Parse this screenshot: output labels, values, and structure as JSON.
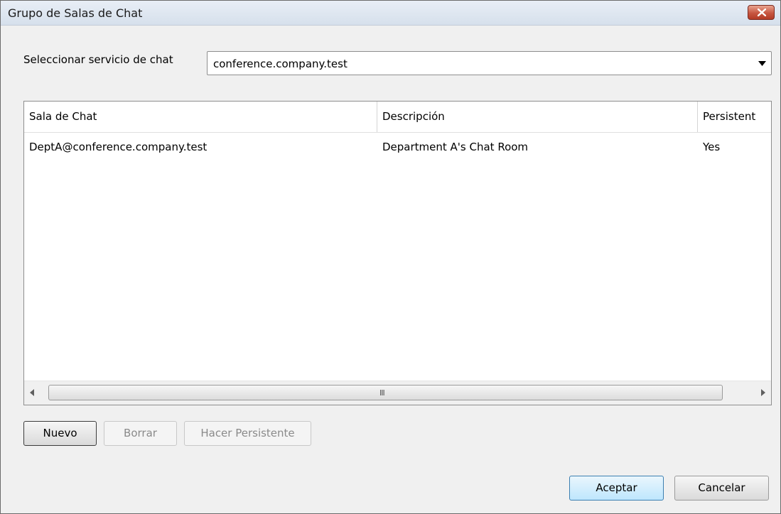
{
  "window": {
    "title": "Grupo de Salas de Chat"
  },
  "service": {
    "label": "Seleccionar servicio de chat",
    "selected": "conference.company.test"
  },
  "table": {
    "columns": [
      "Sala de Chat",
      "Descripción",
      "Persistent"
    ],
    "rows": [
      [
        "DeptA@conference.company.test",
        "Department A's Chat Room",
        "Yes"
      ]
    ]
  },
  "scrollbar": {
    "grip": "III"
  },
  "actions": {
    "new": "Nuevo",
    "delete": "Borrar",
    "make_persistent": "Hacer Persistente"
  },
  "footer": {
    "accept": "Aceptar",
    "cancel": "Cancelar"
  }
}
